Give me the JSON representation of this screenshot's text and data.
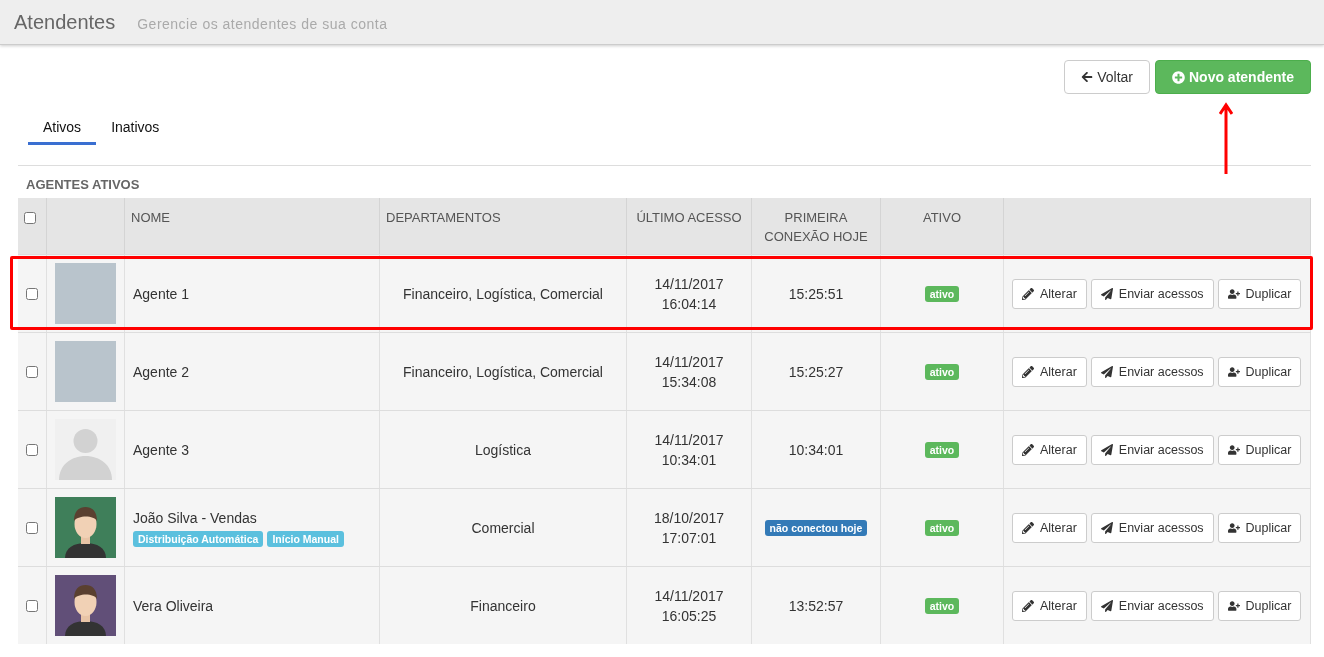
{
  "header": {
    "title": "Atendentes",
    "subtitle": "Gerencie os atendentes de sua conta"
  },
  "actions": {
    "back": "Voltar",
    "new": "Novo atendente",
    "new_annotated": true
  },
  "tabs": [
    {
      "label": "Ativos",
      "selected": true
    },
    {
      "label": "Inativos",
      "selected": false
    }
  ],
  "section_title": "AGENTES ATIVOS",
  "table": {
    "select_all_checked": false,
    "columns": [
      "NOME",
      "DEPARTAMENTOS",
      "ÚLTIMO ACESSO",
      "PRIMEIRA CONEXÃO HOJE",
      "ATIVO"
    ],
    "rows": [
      {
        "checked": false,
        "highlighted": true,
        "avatar": {
          "kind": "photo"
        },
        "name": "Agente 1",
        "tags": [],
        "departments": "Financeiro, Logística, Comercial",
        "last_access": [
          "14/11/2017",
          "16:04:14"
        ],
        "first_connection": {
          "kind": "time",
          "text": "15:25:51"
        },
        "status": "ativo",
        "buttons": [
          "Alterar",
          "Enviar acessos",
          "Duplicar"
        ]
      },
      {
        "checked": false,
        "highlighted": false,
        "avatar": {
          "kind": "photo"
        },
        "name": "Agente 2",
        "tags": [],
        "departments": "Financeiro, Logística, Comercial",
        "last_access": [
          "14/11/2017",
          "15:34:08"
        ],
        "first_connection": {
          "kind": "time",
          "text": "15:25:27"
        },
        "status": "ativo",
        "buttons": [
          "Alterar",
          "Enviar acessos",
          "Duplicar"
        ]
      },
      {
        "checked": false,
        "highlighted": false,
        "avatar": {
          "kind": "silhouette"
        },
        "name": "Agente 3",
        "tags": [],
        "departments": "Logística",
        "last_access": [
          "14/11/2017",
          "10:34:01"
        ],
        "first_connection": {
          "kind": "time",
          "text": "10:34:01"
        },
        "status": "ativo",
        "buttons": [
          "Alterar",
          "Enviar acessos",
          "Duplicar"
        ]
      },
      {
        "checked": false,
        "highlighted": false,
        "avatar": {
          "kind": "illustration",
          "color": "#3f7f5a"
        },
        "name": "João Silva - Vendas",
        "tags": [
          "Distribuição Automática",
          "Início Manual"
        ],
        "departments": "Comercial",
        "last_access": [
          "18/10/2017",
          "17:07:01"
        ],
        "first_connection": {
          "kind": "badge",
          "text": "não conectou hoje"
        },
        "status": "ativo",
        "buttons": [
          "Alterar",
          "Enviar acessos",
          "Duplicar"
        ]
      },
      {
        "checked": false,
        "highlighted": false,
        "avatar": {
          "kind": "illustration",
          "color": "#614f78"
        },
        "name": "Vera Oliveira",
        "tags": [],
        "departments": "Financeiro",
        "last_access": [
          "14/11/2017",
          "16:05:25"
        ],
        "first_connection": {
          "kind": "time",
          "text": "13:52:57"
        },
        "status": "ativo",
        "buttons": [
          "Alterar",
          "Enviar acessos",
          "Duplicar"
        ]
      }
    ]
  }
}
